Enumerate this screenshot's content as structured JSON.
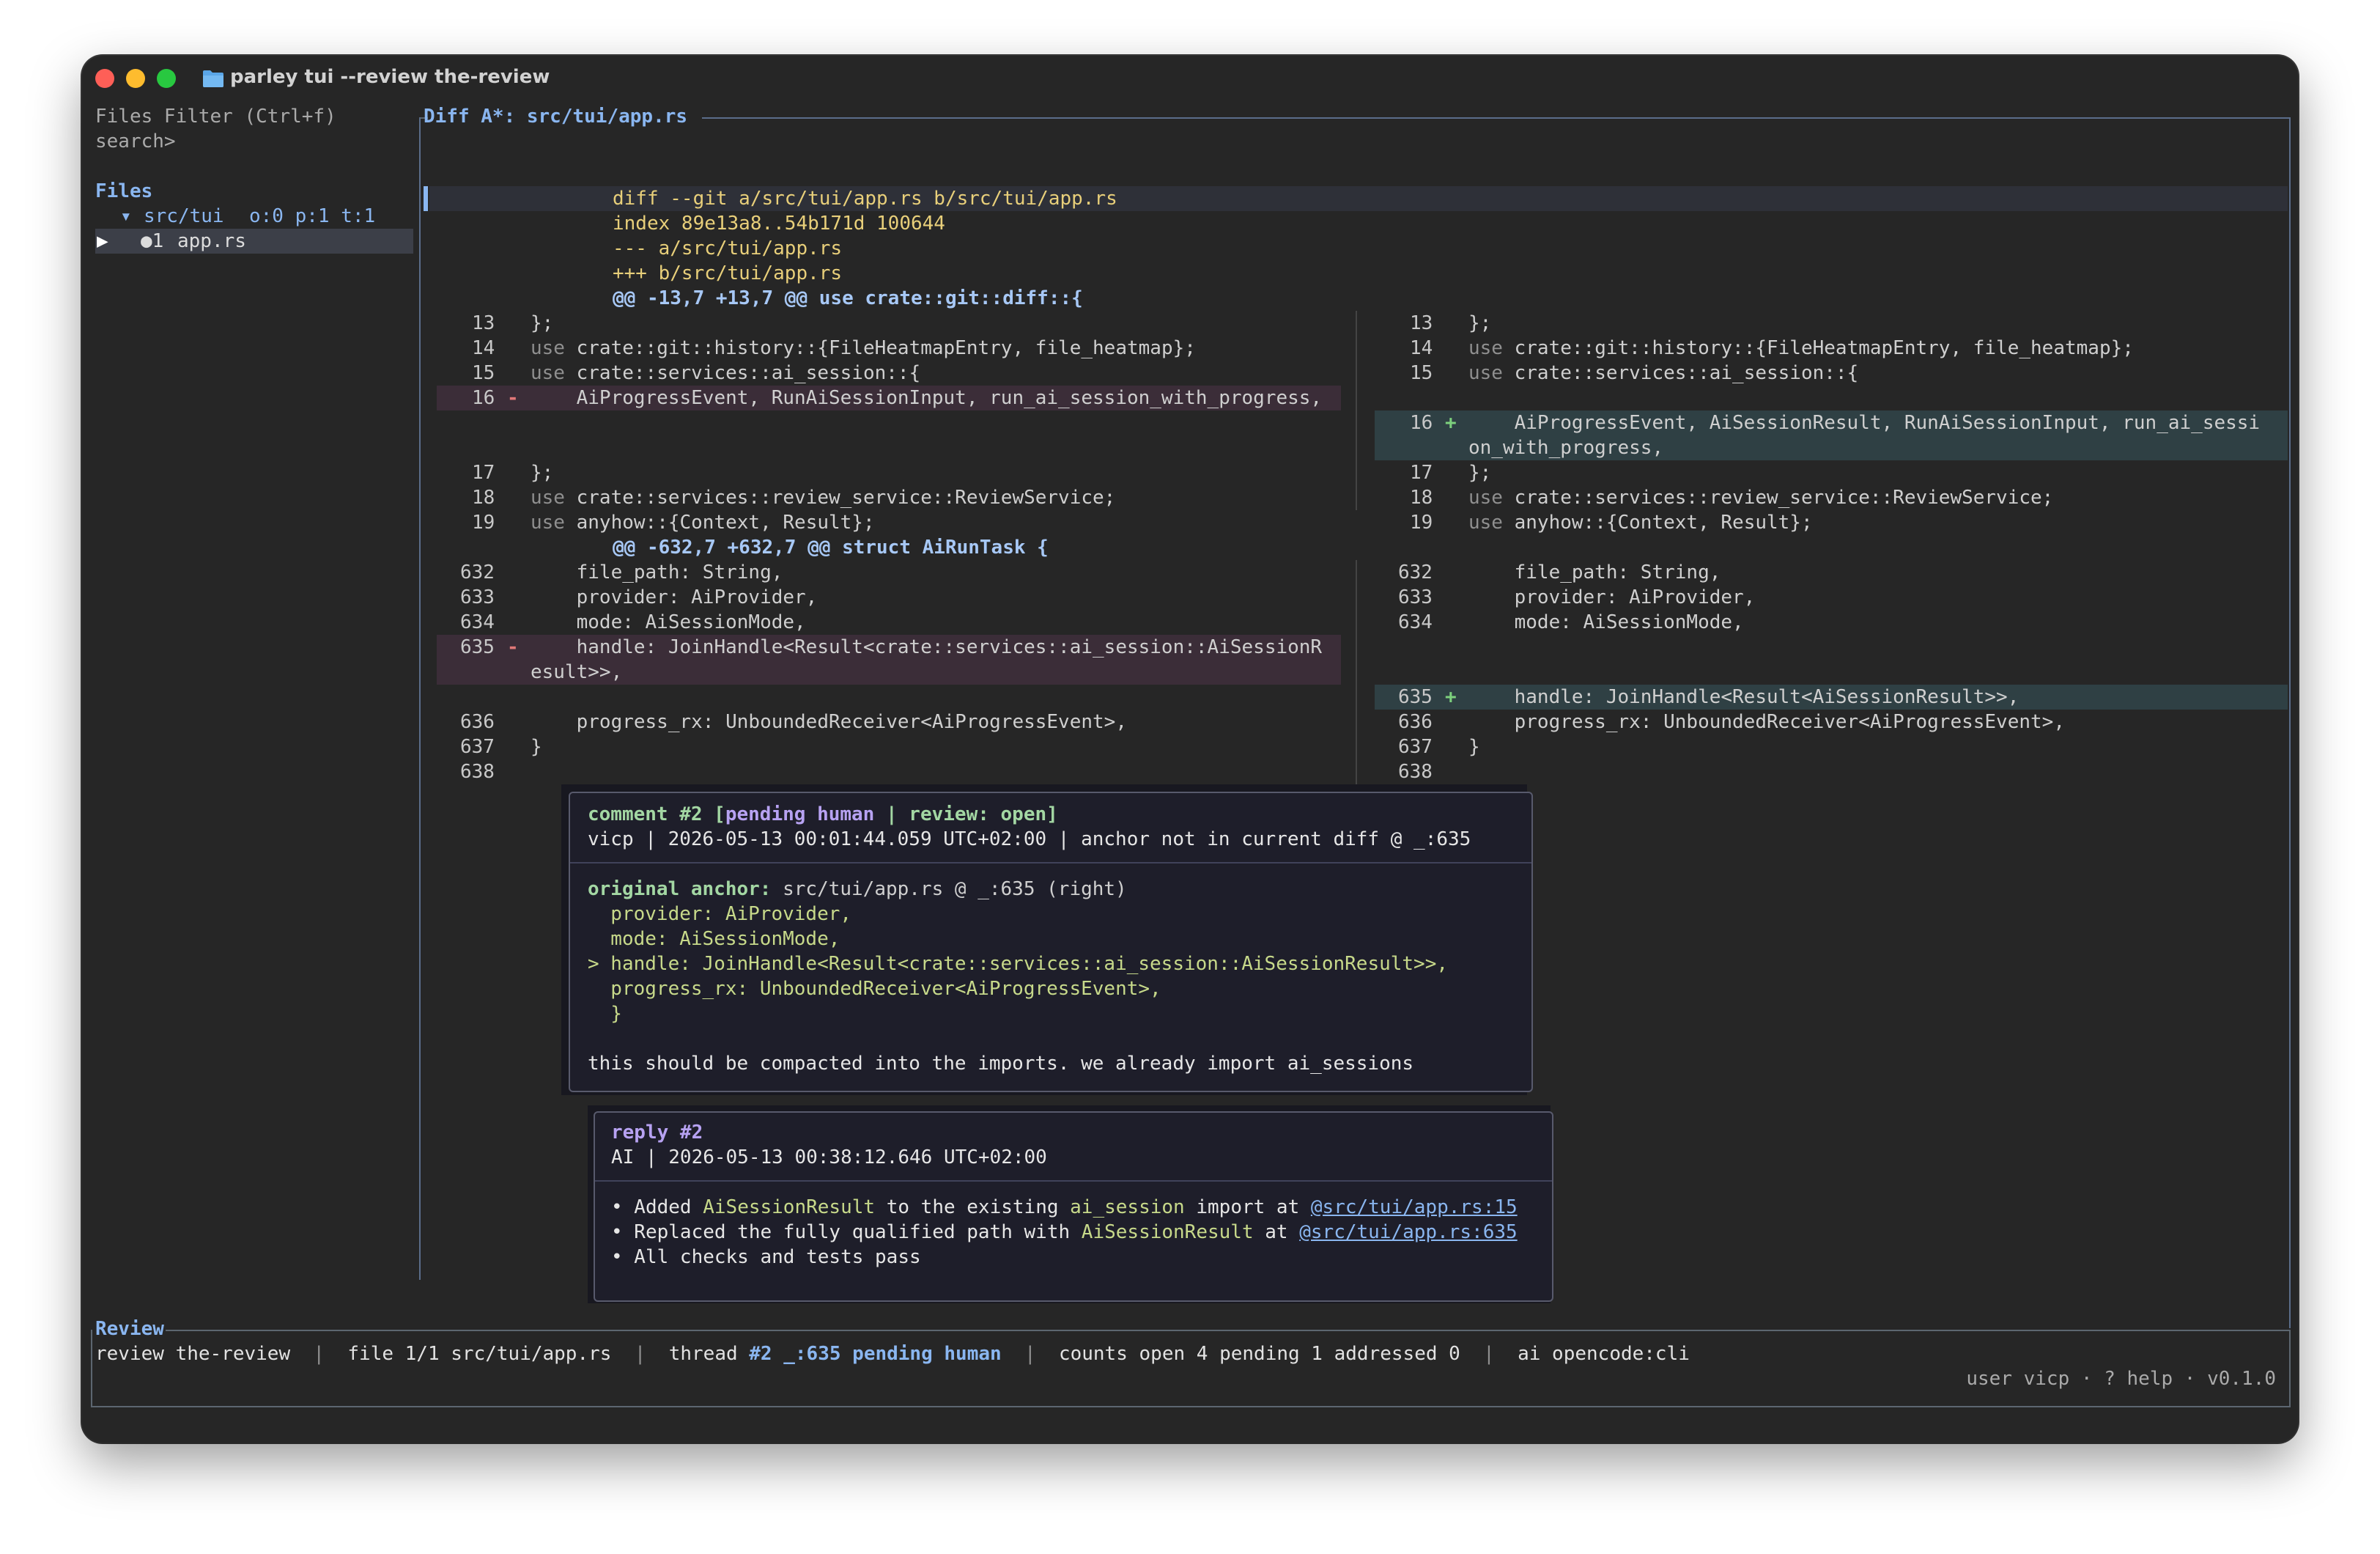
{
  "window": {
    "title": "parley tui --review the-review"
  },
  "colors": {
    "accent": "#8ab6f0",
    "removed_bg": "#3b2d38",
    "added_bg": "#2f4044",
    "terminal_bg": "#262626"
  },
  "sidebar": {
    "header": "Files Filter (Ctrl+f)",
    "search": "search>",
    "files_title": "Files",
    "dir_arrow": "▾",
    "dir_name": "src/tui",
    "dir_stats": "o:0 p:1 t:1",
    "file_marker": "▶",
    "file_badge": "●1",
    "file_name": "app.rs"
  },
  "diff": {
    "title": "Diff A*: src/tui/app.rs",
    "header_lines": [
      "diff --git a/src/tui/app.rs b/src/tui/app.rs",
      "index 89e13a8..54b171d 100644",
      "--- a/src/tui/app.rs",
      "+++ b/src/tui/app.rs"
    ],
    "hunk1": "@@ -13,7 +13,7 @@ use crate::git::diff::{",
    "hunk2": "@@ -632,7 +632,7 @@ struct AiRunTask {",
    "left": {
      "l13": {
        "num": "13",
        "text": "};"
      },
      "l14": {
        "num": "14",
        "kw": "use",
        "text": " crate::git::history::{FileHeatmapEntry, file_heatmap};"
      },
      "l15": {
        "num": "15",
        "kw": "use",
        "text": " crate::services::ai_session::{"
      },
      "l16": {
        "num": "16",
        "sign": "-",
        "text": "    AiProgressEvent, RunAiSessionInput, run_ai_session_with_progress,"
      },
      "l17": {
        "num": "17",
        "text": "};"
      },
      "l18": {
        "num": "18",
        "kw": "use",
        "text": " crate::services::review_service::ReviewService;"
      },
      "l19": {
        "num": "19",
        "kw": "use",
        "text": " anyhow::{Context, Result};"
      },
      "l632": {
        "num": "632",
        "text": "    file_path: String,"
      },
      "l633": {
        "num": "633",
        "text": "    provider: AiProvider,"
      },
      "l634": {
        "num": "634",
        "text": "    mode: AiSessionMode,"
      },
      "l635": {
        "num": "635",
        "sign": "-",
        "text": "    handle: JoinHandle<Result<crate::services::ai_session::AiSessionR",
        "wrap": "esult>>,"
      },
      "l636": {
        "num": "636",
        "text": "    progress_rx: UnboundedReceiver<AiProgressEvent>,"
      },
      "l637": {
        "num": "637",
        "text": "}"
      },
      "l638": {
        "num": "638",
        "text": ""
      }
    },
    "right": {
      "l13": {
        "num": "13",
        "text": "};"
      },
      "l14": {
        "num": "14",
        "kw": "use",
        "text": " crate::git::history::{FileHeatmapEntry, file_heatmap};"
      },
      "l15": {
        "num": "15",
        "kw": "use",
        "text": " crate::services::ai_session::{"
      },
      "l16": {
        "num": "16",
        "sign": "+",
        "text": "    AiProgressEvent, AiSessionResult, RunAiSessionInput, run_ai_sessi",
        "wrap": "on_with_progress,"
      },
      "l17": {
        "num": "17",
        "text": "};"
      },
      "l18": {
        "num": "18",
        "kw": "use",
        "text": " crate::services::review_service::ReviewService;"
      },
      "l19": {
        "num": "19",
        "kw": "use",
        "text": " anyhow::{Context, Result};"
      },
      "l632": {
        "num": "632",
        "text": "    file_path: String,"
      },
      "l633": {
        "num": "633",
        "text": "    provider: AiProvider,"
      },
      "l634": {
        "num": "634",
        "text": "    mode: AiSessionMode,"
      },
      "l635": {
        "num": "635",
        "sign": "+",
        "text": "    handle: JoinHandle<Result<AiSessionResult>>,"
      },
      "l636": {
        "num": "636",
        "text": "    progress_rx: UnboundedReceiver<AiProgressEvent>,"
      },
      "l637": {
        "num": "637",
        "text": "}"
      },
      "l638": {
        "num": "638",
        "text": ""
      }
    }
  },
  "comment": {
    "head_a": "comment #2 [",
    "status": "pending human",
    "head_b": " | review: open]",
    "meta": "vicp | 2026-05-13 00:01:44.059 UTC+02:00 | anchor not in current diff @ _:635",
    "anchor_label": "original anchor:",
    "anchor_value": " src/tui/app.rs @ _:635 (right)",
    "ctx1_key": "  provider: ",
    "ctx1_val": "AiProvider,",
    "ctx2_key": "  mode: ",
    "ctx2_val": "AiSessionMode,",
    "ctx3_key": "> handle: ",
    "ctx3_val": "JoinHandle<Result<crate::services::ai_session::AiSessionResult>>,",
    "ctx4_key": "  progress_rx: ",
    "ctx4_val": "UnboundedReceiver<AiProgressEvent>,",
    "ctx5": "  }",
    "body": "this should be compacted into the imports. we already import ai_sessions"
  },
  "reply": {
    "head": "reply #2",
    "meta": "AI | 2026-05-13 00:38:12.646 UTC+02:00",
    "b1_a": "• Added ",
    "b1_code": "AiSessionResult",
    "b1_b": " to the existing ",
    "b1_code2": "ai_session",
    "b1_c": " import at ",
    "b1_link": "@src/tui/app.rs:15",
    "b2_a": "• Replaced the fully qualified path with ",
    "b2_code": "AiSessionResult",
    "b2_b": " at ",
    "b2_link": "@src/tui/app.rs:635",
    "b3": "• All checks and tests pass"
  },
  "review": {
    "title": "Review",
    "name": "review the-review",
    "file": "file 1/1 src/tui/app.rs",
    "thread_label": "thread ",
    "thread_value": "#2 _:635 pending human",
    "counts": "counts open 4 pending 1 addressed 0",
    "ai": "ai opencode:cli",
    "sep": "|",
    "footer": "user vicp · ? help · v0.1.0"
  }
}
